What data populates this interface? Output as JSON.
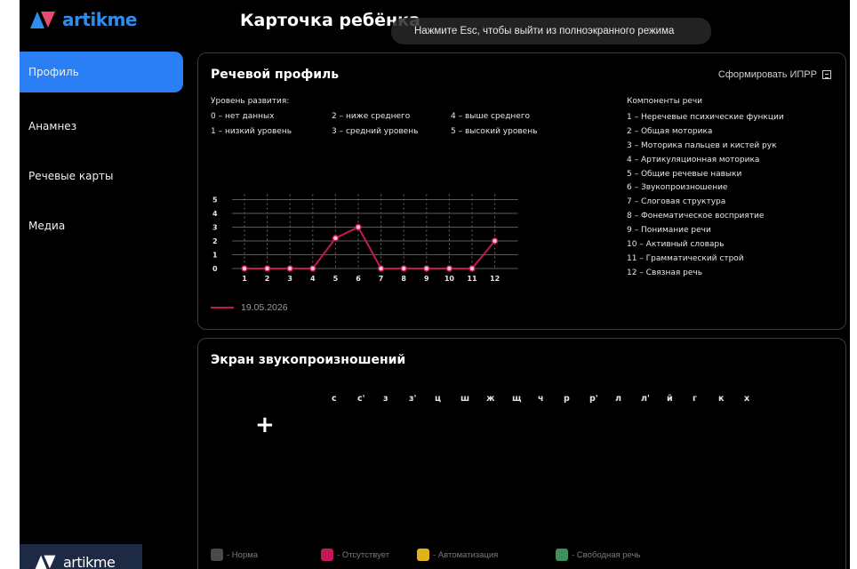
{
  "brand": {
    "name": "artikme"
  },
  "page_title": "Карточка ребёнка",
  "fullscreen_toast": "Нажмите Esc, чтобы выйти из полноэкранного режима",
  "sidebar": {
    "items": [
      {
        "label": "Профиль",
        "active": true
      },
      {
        "label": "Анамнез",
        "active": false
      },
      {
        "label": "Речевые карты",
        "active": false
      },
      {
        "label": "Медиа",
        "active": false
      }
    ],
    "footer_brand": "artikme"
  },
  "speech_profile": {
    "title": "Речевой профиль",
    "ipr_button": "Сформировать ИПРР",
    "levels_title": "Уровень развития:",
    "levels": [
      "0 – нет данных",
      "2 – ниже среднего",
      "4 – выше среднего",
      "1 – низкий уровень",
      "3 – средний уровень",
      "5 – высокий уровень"
    ],
    "components_title": "Компоненты речи",
    "components": [
      "1 – Неречевые психические функции",
      "2 – Общая моторика",
      "3 – Моторика пальцев и кистей рук",
      "4 – Артикуляционная моторика",
      "5 – Общие речевые навыки",
      "6 – Звукопроизношение",
      "7 – Слоговая структура",
      "8 – Фонематическое восприятие",
      "9 – Понимание речи",
      "10 – Активный словарь",
      "11 – Грамматический строй",
      "12 – Связная речь"
    ]
  },
  "chart_data": {
    "type": "line",
    "x": [
      1,
      2,
      3,
      4,
      5,
      6,
      7,
      8,
      9,
      10,
      11,
      12
    ],
    "series": [
      {
        "name": "19.05.2026",
        "values": [
          0,
          0,
          0,
          0,
          2.2,
          3,
          0,
          0,
          0,
          0,
          0,
          2
        ]
      }
    ],
    "xticks": [
      "1",
      "2",
      "3",
      "4",
      "5",
      "6",
      "7",
      "8",
      "9",
      "10",
      "11",
      "12"
    ],
    "yticks": [
      "0",
      "1",
      "2",
      "3",
      "4",
      "5"
    ],
    "ylim": [
      0,
      5
    ],
    "grid": true,
    "color": "#c2185b",
    "legend": "bottom-left"
  },
  "sound_screen": {
    "title": "Экран звукопроизношений",
    "sounds": [
      "с",
      "с'",
      "з",
      "з'",
      "ц",
      "ш",
      "ж",
      "щ",
      "ч",
      "р",
      "р'",
      "л",
      "л'",
      "й",
      "г",
      "к",
      "х"
    ],
    "add_symbol": "+",
    "statuses": [
      {
        "label": "- Норма",
        "color": "#4a4a4a"
      },
      {
        "label": "- Отсутствует",
        "color": "#c2185b"
      },
      {
        "label": "- Автоматизация",
        "color": "#e0b21a"
      },
      {
        "label": "- Свободная речь",
        "color": "#3f8f5a"
      }
    ]
  }
}
